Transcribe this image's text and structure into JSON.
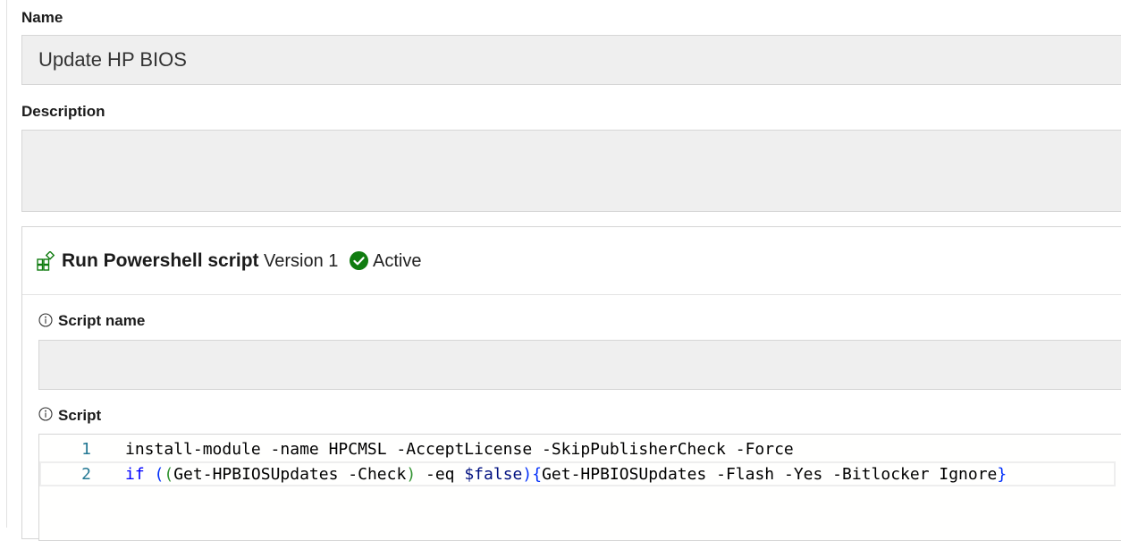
{
  "form": {
    "name_label": "Name",
    "name_value": "Update HP BIOS",
    "description_label": "Description",
    "description_value": ""
  },
  "step": {
    "title": "Run Powershell script",
    "version": "Version 1",
    "status": "Active",
    "status_color": "#107c10",
    "icon": "add-step-icon"
  },
  "script_name": {
    "label": "Script name",
    "value": ""
  },
  "script": {
    "label": "Script",
    "lines": [
      {
        "number": "1",
        "text": "install-module -name HPCMSL -AcceptLicense -SkipPublisherCheck -Force"
      },
      {
        "number": "2",
        "text": "if ((Get-HPBIOSUpdates -Check) -eq $false){Get-HPBIOSUpdates -Flash -Yes -Bitlocker Ignore}"
      }
    ]
  },
  "colors": {
    "keyword": "#0000ff",
    "line_number": "#237893",
    "field_bg": "#efefef"
  }
}
